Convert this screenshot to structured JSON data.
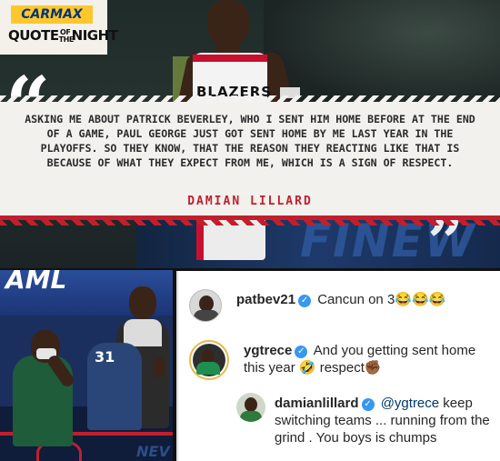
{
  "badge": {
    "brand": "CARMAX",
    "title_left": "QUOTE",
    "title_small_top": "OF",
    "title_small_bottom": "THE",
    "title_right": "NIGHT"
  },
  "photo": {
    "jersey_text": "BLAZERS",
    "court_text": "FINEW",
    "open_quote": "“",
    "close_quote": "”"
  },
  "quote": {
    "text": "ASKING ME ABOUT PATRICK BEVERLEY, WHO I SENT HIM HOME BEFORE AT THE END OF A GAME, PAUL GEORGE JUST GOT SENT HOME BY ME LAST YEAR IN THE PLAYOFFS. SO THEY KNOW, THAT THE REASON THEY REACTING LIKE THAT IS BECAUSE OF WHAT THEY EXPECT FROM ME, WHICH IS A SIGN OF RESPECT.",
    "author": "DAMIAN LILLARD"
  },
  "bench_photo": {
    "banner_text": "AML",
    "jersey_number": "31",
    "floor_text": "NEV"
  },
  "comments": [
    {
      "username": "patbev21",
      "verified": true,
      "text": "Cancun on 3😂😂😂"
    },
    {
      "username": "ygtrece",
      "verified": true,
      "text": "And you getting sent home this year 🤣 respect✊🏾"
    },
    {
      "username": "damianlillard",
      "verified": true,
      "mention": "@ygtrece",
      "text": " keep switching teams ... running from the grind . You boys is chumps"
    }
  ]
}
